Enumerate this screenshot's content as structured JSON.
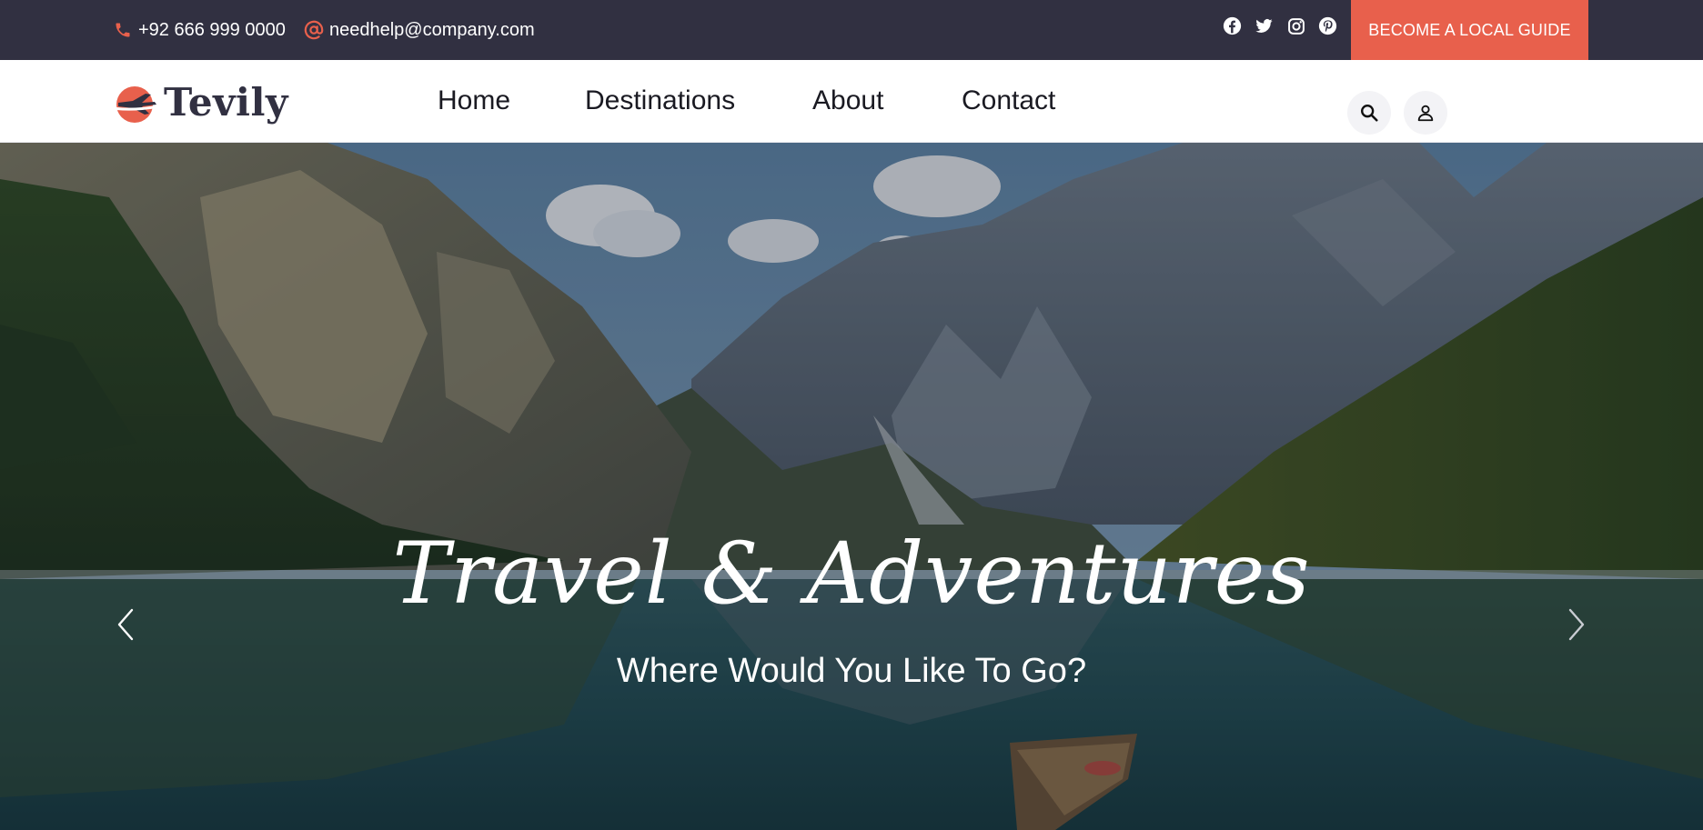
{
  "topbar": {
    "phone": "+92 666 999 0000",
    "phone_icon": "phone-icon",
    "email": "needhelp@company.com",
    "email_icon": "at-sign-icon",
    "socials": [
      "facebook-icon",
      "twitter-icon",
      "instagram-icon",
      "pinterest-icon"
    ],
    "guide_button": "BECOME A LOCAL GUIDE"
  },
  "navbar": {
    "logo_text": "Tevily",
    "links": [
      "Home",
      "Destinations",
      "About",
      "Contact"
    ],
    "search_icon": "search-icon",
    "user_icon": "user-icon"
  },
  "hero": {
    "title": "Travel & Adventures",
    "subtitle": "Where Would You Like To Go?",
    "prev_icon": "chevron-left-icon",
    "next_icon": "chevron-right-icon"
  },
  "colors": {
    "topbar_bg": "#313041",
    "accent": "#e8604c",
    "nav_text": "#1a1a22",
    "logo_text": "#313041"
  }
}
